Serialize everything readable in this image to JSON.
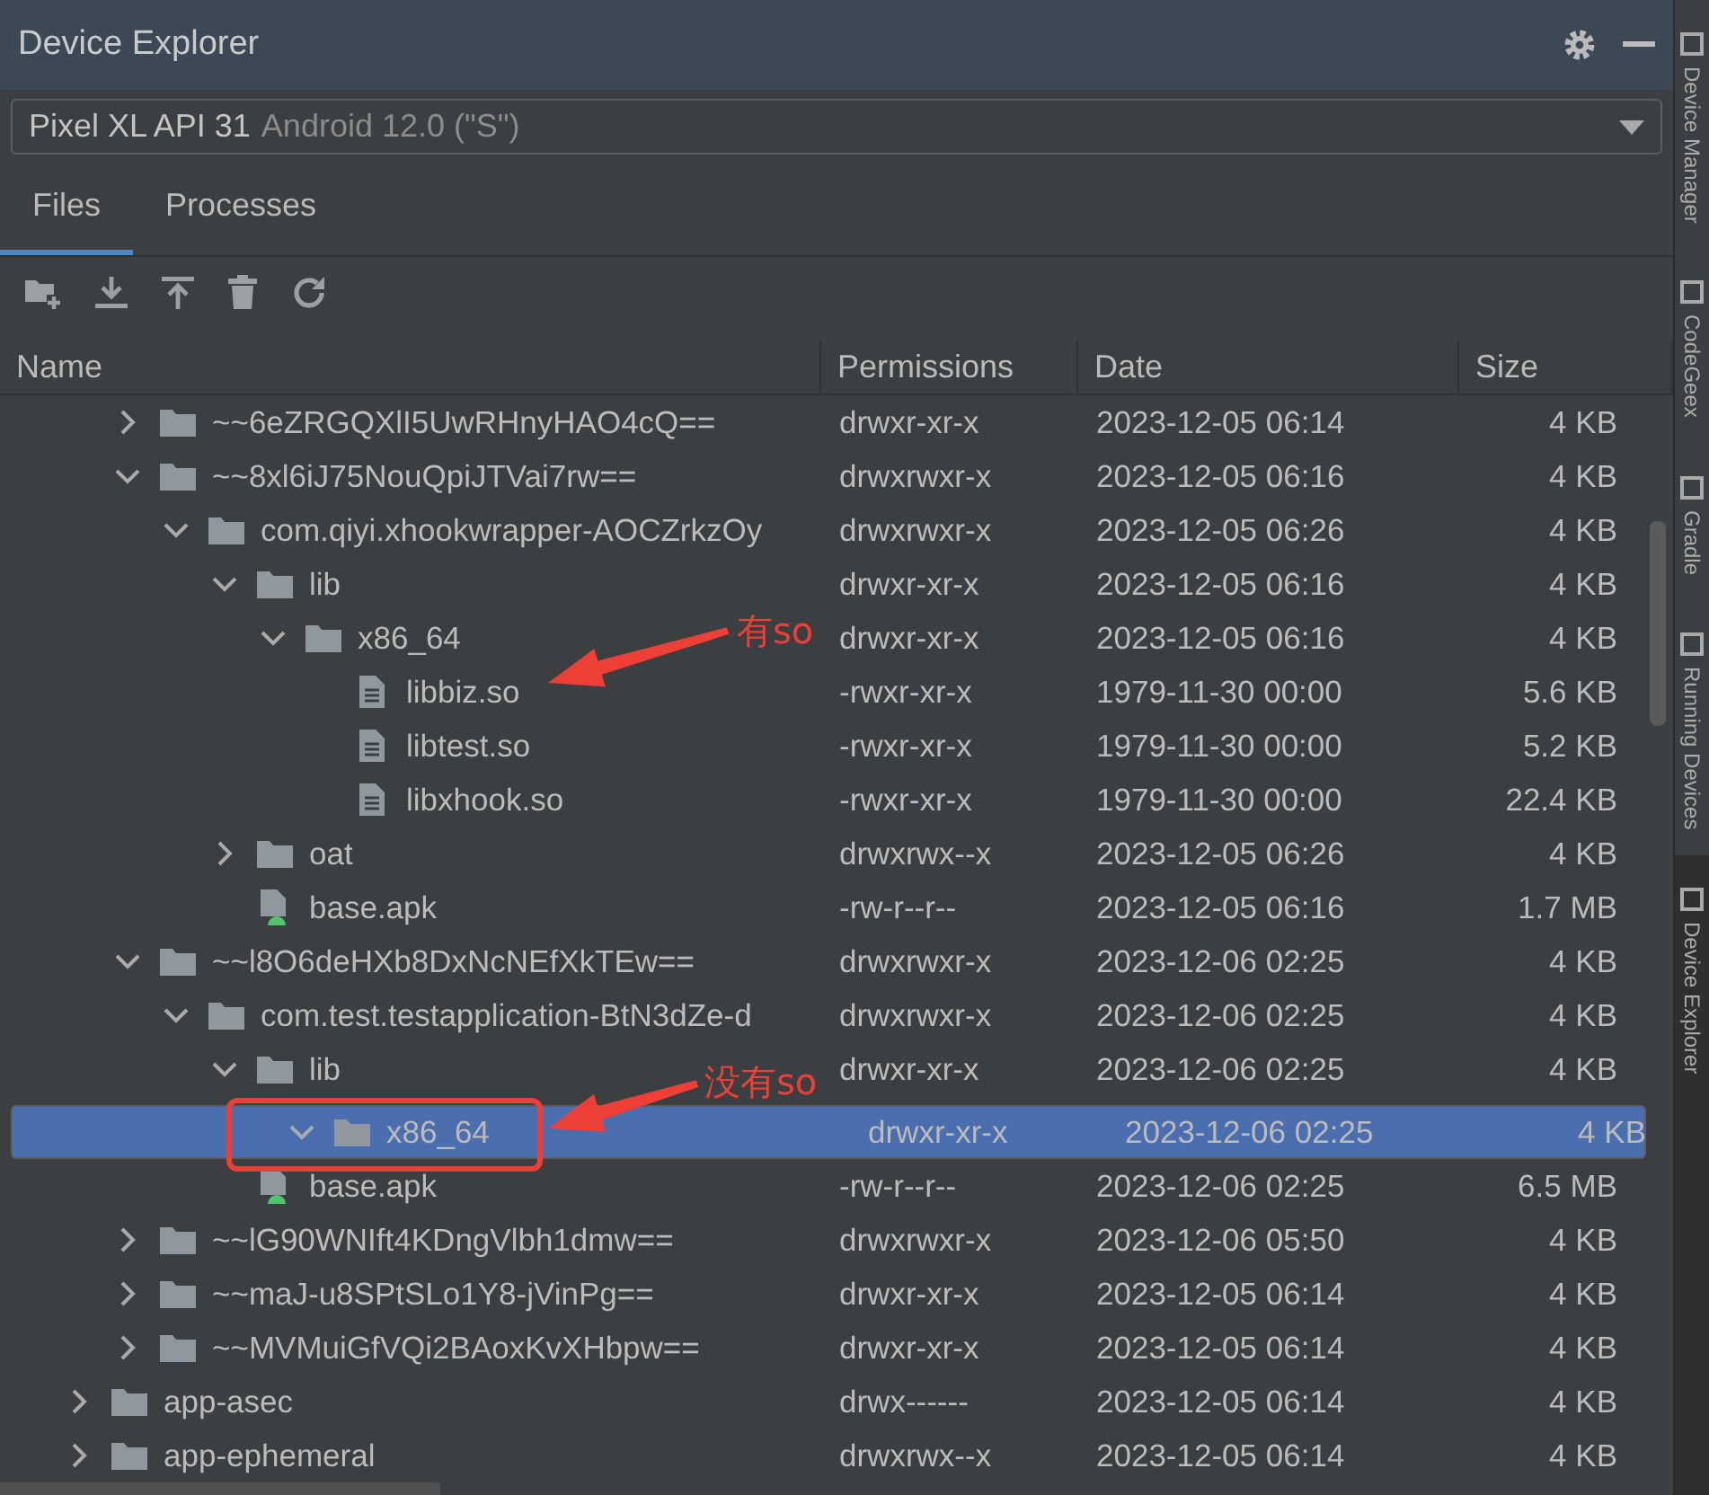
{
  "window": {
    "title": "Device Explorer"
  },
  "device_select": {
    "device": "Pixel XL API 31",
    "detail": "Android 12.0 (\"S\")"
  },
  "tabs": [
    {
      "label": "Files",
      "selected": true
    },
    {
      "label": "Processes",
      "selected": false
    }
  ],
  "table": {
    "columns": [
      "Name",
      "Permissions",
      "Date",
      "Size"
    ]
  },
  "tree": [
    {
      "children": [
        {
          "name": "~~6eZRGQXlI5UwRHnyHAO4cQ==",
          "kind": "folder",
          "expanded": false,
          "selected": false,
          "permissions": "drwxr-xr-x",
          "date": "2023-12-05 06:14",
          "size": "4 KB"
        },
        {
          "name": "~~8xl6iJ75NouQpiJTVai7rw==",
          "kind": "folder",
          "expanded": true,
          "selected": false,
          "permissions": "drwxrwxr-x",
          "date": "2023-12-05 06:16",
          "size": "4 KB",
          "children": [
            {
              "name": "com.qiyi.xhookwrapper-AOCZrkzOy",
              "kind": "folder",
              "expanded": true,
              "selected": false,
              "permissions": "drwxrwxr-x",
              "date": "2023-12-05 06:26",
              "size": "4 KB",
              "children": [
                {
                  "name": "lib",
                  "kind": "folder",
                  "expanded": true,
                  "selected": false,
                  "permissions": "drwxr-xr-x",
                  "date": "2023-12-05 06:16",
                  "size": "4 KB",
                  "children": [
                    {
                      "name": "x86_64",
                      "kind": "folder",
                      "expanded": true,
                      "selected": false,
                      "permissions": "drwxr-xr-x",
                      "date": "2023-12-05 06:16",
                      "size": "4 KB",
                      "children": [
                        {
                          "name": "libbiz.so",
                          "kind": "file",
                          "selected": false,
                          "permissions": "-rwxr-xr-x",
                          "date": "1979-11-30 00:00",
                          "size": "5.6 KB"
                        },
                        {
                          "name": "libtest.so",
                          "kind": "file",
                          "selected": false,
                          "permissions": "-rwxr-xr-x",
                          "date": "1979-11-30 00:00",
                          "size": "5.2 KB"
                        },
                        {
                          "name": "libxhook.so",
                          "kind": "file",
                          "selected": false,
                          "permissions": "-rwxr-xr-x",
                          "date": "1979-11-30 00:00",
                          "size": "22.4 KB"
                        }
                      ]
                    }
                  ]
                },
                {
                  "name": "oat",
                  "kind": "folder",
                  "expanded": false,
                  "selected": false,
                  "permissions": "drwxrwx--x",
                  "date": "2023-12-05 06:26",
                  "size": "4 KB"
                },
                {
                  "name": "base.apk",
                  "kind": "apk",
                  "selected": false,
                  "permissions": "-rw-r--r--",
                  "date": "2023-12-05 06:16",
                  "size": "1.7 MB"
                }
              ]
            }
          ]
        },
        {
          "name": "~~l8O6deHXb8DxNcNEfXkTEw==",
          "kind": "folder",
          "expanded": true,
          "selected": false,
          "permissions": "drwxrwxr-x",
          "date": "2023-12-06 02:25",
          "size": "4 KB",
          "children": [
            {
              "name": "com.test.testapplication-BtN3dZe-d",
              "kind": "folder",
              "expanded": true,
              "selected": false,
              "permissions": "drwxrwxr-x",
              "date": "2023-12-06 02:25",
              "size": "4 KB",
              "children": [
                {
                  "name": "lib",
                  "kind": "folder",
                  "expanded": true,
                  "selected": false,
                  "permissions": "drwxr-xr-x",
                  "date": "2023-12-06 02:25",
                  "size": "4 KB",
                  "children": [
                    {
                      "name": "x86_64",
                      "kind": "folder",
                      "expanded": true,
                      "selected": true,
                      "permissions": "drwxr-xr-x",
                      "date": "2023-12-06 02:25",
                      "size": "4 KB"
                    }
                  ]
                },
                {
                  "name": "base.apk",
                  "kind": "apk",
                  "selected": false,
                  "permissions": "-rw-r--r--",
                  "date": "2023-12-06 02:25",
                  "size": "6.5 MB"
                }
              ]
            }
          ]
        },
        {
          "name": "~~lG90WNIft4KDngVlbh1dmw==",
          "kind": "folder",
          "expanded": false,
          "selected": false,
          "permissions": "drwxrwxr-x",
          "date": "2023-12-06 05:50",
          "size": "4 KB"
        },
        {
          "name": "~~maJ-u8SPtSLo1Y8-jVinPg==",
          "kind": "folder",
          "expanded": false,
          "selected": false,
          "permissions": "drwxr-xr-x",
          "date": "2023-12-05 06:14",
          "size": "4 KB"
        },
        {
          "name": "~~MVMuiGfVQi2BAoxKvXHbpw==",
          "kind": "folder",
          "expanded": false,
          "selected": false,
          "permissions": "drwxr-xr-x",
          "date": "2023-12-05 06:14",
          "size": "4 KB"
        }
      ]
    },
    {
      "name": "app-asec",
      "kind": "folder",
      "expanded": false,
      "selected": false,
      "permissions": "drwx------",
      "date": "2023-12-05 06:14",
      "size": "4 KB"
    },
    {
      "name": "app-ephemeral",
      "kind": "folder",
      "expanded": false,
      "selected": false,
      "permissions": "drwxrwx--x",
      "date": "2023-12-05 06:14",
      "size": "4 KB"
    }
  ],
  "side_strip": [
    {
      "label": "Device Manager",
      "selected": false
    },
    {
      "label": "CodeGeex",
      "selected": false
    },
    {
      "label": "Gradle",
      "selected": false
    },
    {
      "label": "Running Devices",
      "selected": false
    },
    {
      "label": "Device Explorer",
      "selected": true
    }
  ],
  "annotations": [
    {
      "kind": "arrow"
    },
    {
      "kind": "label",
      "text": "有so"
    },
    {
      "kind": "arrow"
    },
    {
      "kind": "label",
      "text": "没有so"
    },
    {
      "kind": "frame"
    }
  ]
}
